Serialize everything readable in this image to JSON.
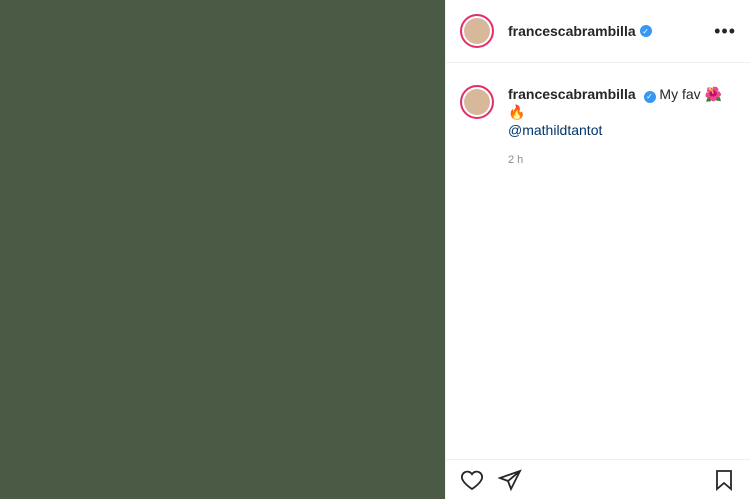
{
  "media": {
    "note": ""
  },
  "author": {
    "username": "francescabrambilla",
    "verified_mark": "✓",
    "more_label": "•••"
  },
  "caption": {
    "username": "francescabrambilla",
    "text": "My fav 🌺🔥",
    "mention": "@mathildtantot",
    "time": "2 h"
  }
}
